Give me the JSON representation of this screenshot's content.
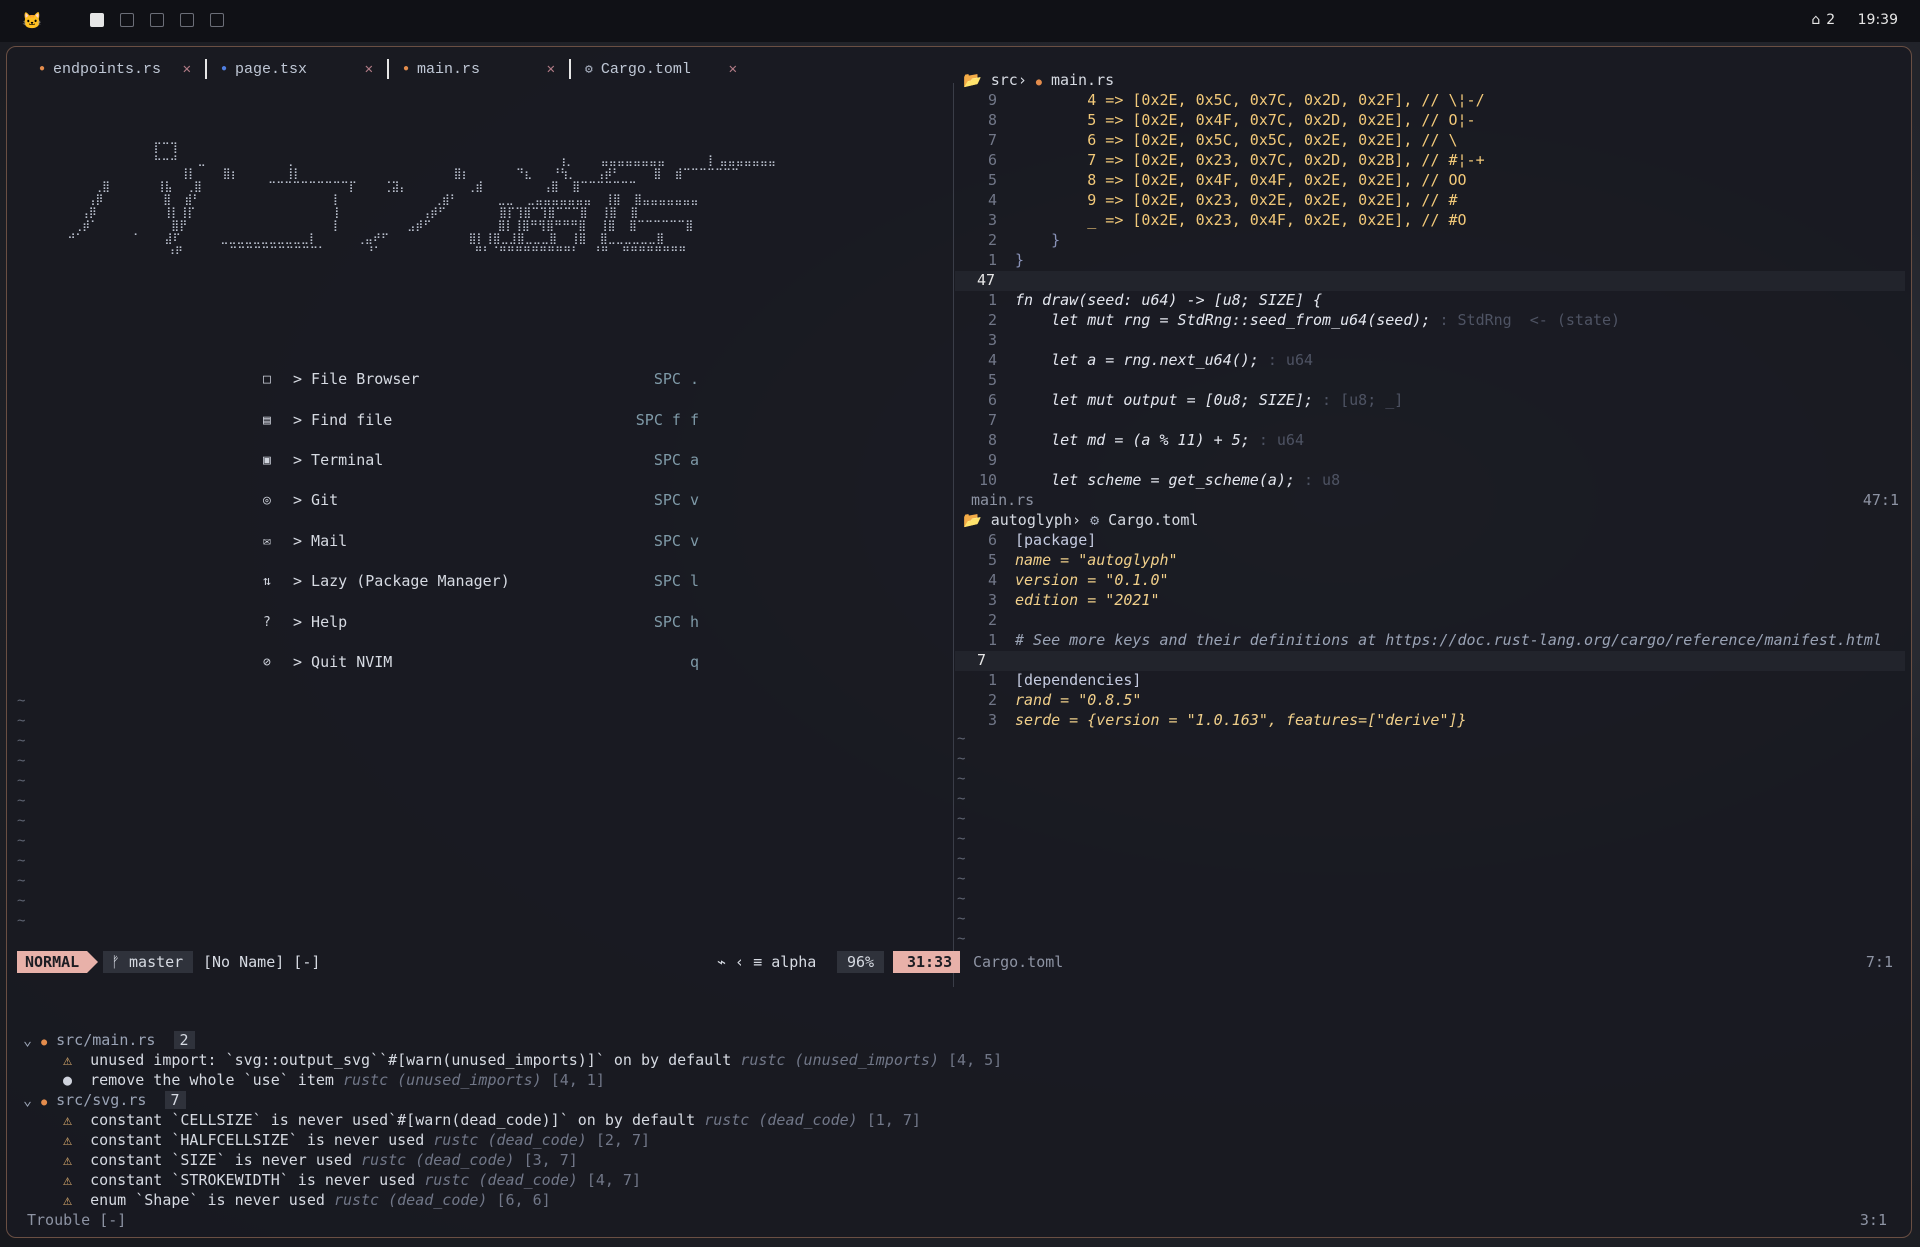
{
  "topbar": {
    "workspaces": [
      "1",
      "2",
      "3",
      "4",
      "5"
    ],
    "notif_count": "2",
    "clock": "19:39"
  },
  "tabs": [
    {
      "label": "endpoints.rs",
      "icon": "rust-file-icon"
    },
    {
      "label": "page.tsx",
      "icon": "react-file-icon"
    },
    {
      "label": "main.rs",
      "icon": "rust-file-icon"
    },
    {
      "label": "Cargo.toml",
      "icon": "gear-icon"
    }
  ],
  "dashboard": {
    "menu": [
      {
        "icon": "□",
        "label": "> File Browser",
        "key": "SPC ."
      },
      {
        "icon": "▤",
        "label": "> Find file",
        "key": "SPC f f"
      },
      {
        "icon": "▣",
        "label": "> Terminal",
        "key": "SPC a"
      },
      {
        "icon": "◎",
        "label": "> Git",
        "key": "SPC v"
      },
      {
        "icon": "✉",
        "label": "> Mail",
        "key": "SPC v"
      },
      {
        "icon": "⇅",
        "label": "> Lazy (Package Manager)",
        "key": "SPC l"
      },
      {
        "icon": "?",
        "label": "> Help",
        "key": "SPC h"
      },
      {
        "icon": "⊘",
        "label": "> Quit NVIM",
        "key": "q"
      }
    ]
  },
  "main_rs": {
    "crumb_dir": "src",
    "crumb_file": "main.rs",
    "top_lines": [
      {
        "n": "9",
        "code": "        4 => [0x2E, 0x5C, 0x7C, 0x2D, 0x2F], // \\¦-/"
      },
      {
        "n": "8",
        "code": "        5 => [0x2E, 0x4F, 0x7C, 0x2D, 0x2E], // O¦-"
      },
      {
        "n": "7",
        "code": "        6 => [0x2E, 0x5C, 0x5C, 0x2E, 0x2E], // \\"
      },
      {
        "n": "6",
        "code": "        7 => [0x2E, 0x23, 0x7C, 0x2D, 0x2B], // #¦-+"
      },
      {
        "n": "5",
        "code": "        8 => [0x2E, 0x4F, 0x4F, 0x2E, 0x2E], // OO"
      },
      {
        "n": "4",
        "code": "        9 => [0x2E, 0x23, 0x2E, 0x2E, 0x2E], // #"
      },
      {
        "n": "3",
        "code": "        _ => [0x2E, 0x23, 0x4F, 0x2E, 0x2E], // #O"
      },
      {
        "n": "2",
        "code": "    }"
      },
      {
        "n": "1",
        "code": "}"
      }
    ],
    "cursor_line": "47",
    "bottom_lines": [
      {
        "n": "1",
        "code": "fn draw(seed: u64) -> [u8; SIZE] {",
        "hint": ""
      },
      {
        "n": "2",
        "code": "    let mut rng = StdRng::seed_from_u64(seed);",
        "hint": " : StdRng  <- (state)"
      },
      {
        "n": "3",
        "code": "",
        "hint": ""
      },
      {
        "n": "4",
        "code": "    let a = rng.next_u64();",
        "hint": " : u64"
      },
      {
        "n": "5",
        "code": "",
        "hint": ""
      },
      {
        "n": "6",
        "code": "    let mut output = [0u8; SIZE];",
        "hint": " : [u8; _]"
      },
      {
        "n": "7",
        "code": "",
        "hint": ""
      },
      {
        "n": "8",
        "code": "    let md = (a % 11) + 5;",
        "hint": " : u64"
      },
      {
        "n": "9",
        "code": "",
        "hint": ""
      },
      {
        "n": "10",
        "code": "    let scheme = get_scheme(a);",
        "hint": " : u8"
      }
    ],
    "winbar_name": "main.rs",
    "winbar_pos": "47:1"
  },
  "cargo": {
    "crumb_dir": "autoglyph",
    "crumb_file": "Cargo.toml",
    "top_lines": [
      {
        "n": "6",
        "code": "[package]"
      },
      {
        "n": "5",
        "code": "name = \"autoglyph\""
      },
      {
        "n": "4",
        "code": "version = \"0.1.0\""
      },
      {
        "n": "3",
        "code": "edition = \"2021\""
      },
      {
        "n": "2",
        "code": ""
      },
      {
        "n": "1",
        "code": "# See more keys and their definitions at https://doc.rust-lang.org/cargo/reference/manifest.html"
      }
    ],
    "cursor_line": "7",
    "bottom_lines": [
      {
        "n": "1",
        "code": "[dependencies]"
      },
      {
        "n": "2",
        "code": "rand = \"0.8.5\""
      },
      {
        "n": "3",
        "code": "serde = {version = \"1.0.163\", features=[\"derive\"]}"
      }
    ]
  },
  "status": {
    "mode": "NORMAL",
    "branch": "master",
    "file": "[No Name] [-]",
    "filetype": "alpha",
    "percent": "96%",
    "position": "31:33",
    "right_file": "Cargo.toml",
    "right_pos": "7:1"
  },
  "trouble": {
    "groups": [
      {
        "file": "src/main.rs",
        "count": "2",
        "items": [
          {
            "sev": "⚠",
            "msg": "unused import: `svg::output_svg``#[warn(unused_imports)]` on by default",
            "src": "rustc (unused_imports)",
            "loc": "[4, 5]"
          },
          {
            "sev": "●",
            "msg": "remove the whole `use` item",
            "src": "rustc (unused_imports)",
            "loc": "[4, 1]"
          }
        ]
      },
      {
        "file": "src/svg.rs",
        "count": "7",
        "items": [
          {
            "sev": "⚠",
            "msg": "constant `CELLSIZE` is never used`#[warn(dead_code)]` on by default",
            "src": "rustc (dead_code)",
            "loc": "[1, 7]"
          },
          {
            "sev": "⚠",
            "msg": "constant `HALFCELLSIZE` is never used",
            "src": "rustc (dead_code)",
            "loc": "[2, 7]"
          },
          {
            "sev": "⚠",
            "msg": "constant `SIZE` is never used",
            "src": "rustc (dead_code)",
            "loc": "[3, 7]"
          },
          {
            "sev": "⚠",
            "msg": "constant `STROKEWIDTH` is never used",
            "src": "rustc (dead_code)",
            "loc": "[4, 7]"
          },
          {
            "sev": "⚠",
            "msg": "enum `Shape` is never used",
            "src": "rustc (dead_code)",
            "loc": "[6, 6]"
          }
        ]
      }
    ],
    "footer": "Trouble [-]",
    "footer_pos": "3:1"
  }
}
